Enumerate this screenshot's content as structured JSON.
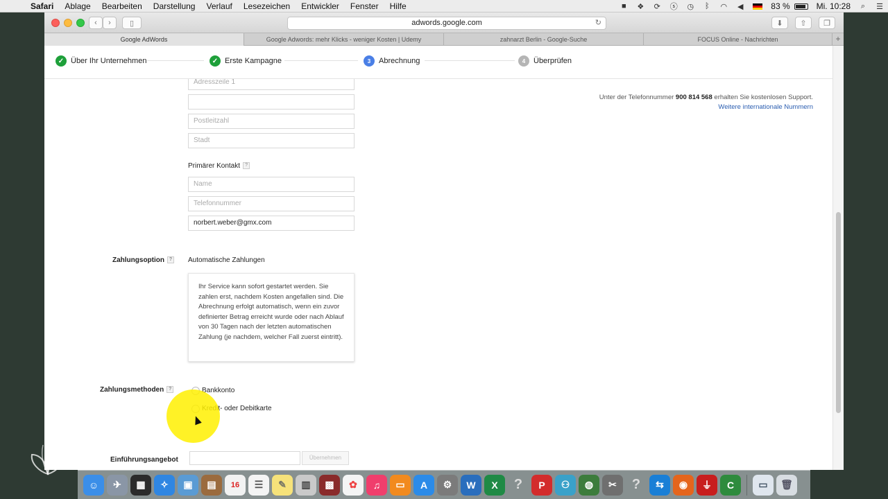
{
  "menubar": {
    "app": "Safari",
    "items": [
      "Ablage",
      "Bearbeiten",
      "Darstellung",
      "Verlauf",
      "Lesezeichen",
      "Entwickler",
      "Fenster",
      "Hilfe"
    ],
    "battery": "83 %",
    "clock": "Mi. 10:28"
  },
  "browser": {
    "url": "adwords.google.com",
    "tabs": [
      "Google AdWords",
      "Google Adwords: mehr Klicks - weniger Kosten | Udemy",
      "zahnarzt Berlin - Google-Suche",
      "FOCUS Online - Nachrichten"
    ]
  },
  "steps": [
    {
      "label": "Über Ihr Unternehmen",
      "state": "done",
      "icon": "check-icon"
    },
    {
      "label": "Erste Kampagne",
      "state": "done",
      "icon": "check-icon"
    },
    {
      "label": "Abrechnung",
      "state": "current",
      "number": "3"
    },
    {
      "label": "Überprüfen",
      "state": "todo",
      "number": "4"
    }
  ],
  "support": {
    "prefix": "Unter der Telefonnummer",
    "number": "900 814 568",
    "suffix": "erhalten Sie kostenlosen Support.",
    "link": "Weitere internationale Nummern"
  },
  "address": {
    "line1_placeholder": "Adresszeile 1",
    "line2_value": "",
    "zip_placeholder": "Postleitzahl",
    "city_placeholder": "Stadt"
  },
  "contact": {
    "label": "Primärer Kontakt",
    "help": "?",
    "name_placeholder": "Name",
    "phone_placeholder": "Telefonnummer",
    "email_value": "norbert.weber@gmx.com"
  },
  "payment_option": {
    "label": "Zahlungsoption",
    "help": "?",
    "value": "Automatische Zahlungen",
    "description": "Ihr Service kann sofort gestartet werden. Sie zahlen erst, nachdem Kosten angefallen sind. Die Abrechnung erfolgt automatisch, wenn ein zuvor definierter Betrag erreicht wurde oder nach Ablauf von 30 Tagen nach der letzten automatischen Zahlung (je nachdem, welcher Fall zuerst eintritt)."
  },
  "payment_methods": {
    "label": "Zahlungsmethoden",
    "help": "?",
    "options": [
      "Bankkonto",
      "Kredit- oder Debitkarte"
    ]
  },
  "intro_offer": {
    "label": "Einführungsangebot",
    "button": "Übernehmen"
  },
  "colors": {
    "done": "#1ea03a",
    "current": "#4a7fe6",
    "todo": "#b5b5b5",
    "highlight": "#fff000",
    "link": "#2a5db0"
  }
}
